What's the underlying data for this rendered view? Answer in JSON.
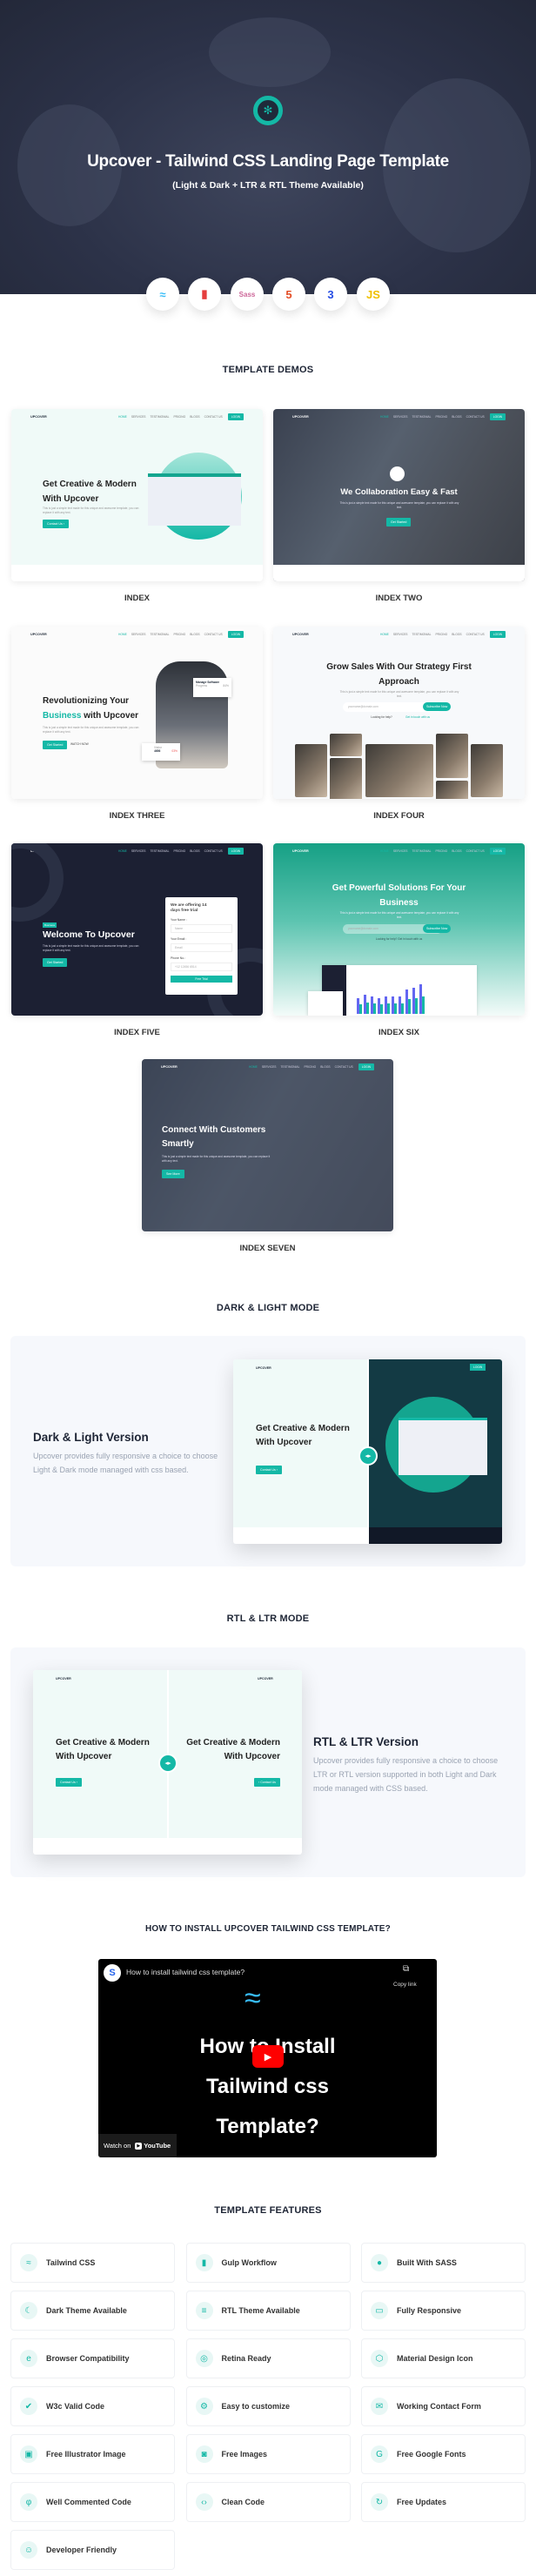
{
  "colors": {
    "accent": "#14b8a6",
    "hero_bg": "#2c3248",
    "dark": "#1c2033"
  },
  "hero": {
    "logo_icon": "upcover-logo-icon",
    "title": "Upcover - Tailwind CSS Landing Page Template",
    "subtitle": "(Light & Dark + LTR & RTL Theme Available)",
    "tech_icons": [
      {
        "name": "tailwind-icon",
        "glyph": "≈",
        "color": "#38bdf8"
      },
      {
        "name": "gulp-icon",
        "glyph": "▮",
        "color": "#e53e3e"
      },
      {
        "name": "sass-icon",
        "glyph": "Sass",
        "color": "#cd6799"
      },
      {
        "name": "html5-icon",
        "glyph": "5",
        "color": "#e44d26"
      },
      {
        "name": "css3-icon",
        "glyph": "3",
        "color": "#264de4"
      },
      {
        "name": "javascript-icon",
        "glyph": "JS",
        "color": "#f0c000"
      }
    ]
  },
  "demos_section": {
    "title": "TEMPLATE DEMOS"
  },
  "mock": {
    "brand": "UPCOVER",
    "nav": [
      "HOME",
      "SERVICES",
      "TESTIMONIAL",
      "PRICING",
      "BLOGS",
      "CONTACT US"
    ],
    "login": "LOGIN",
    "para": "This is just a simple text made for this unique and awesome template, you can replace it with any text."
  },
  "demos": [
    {
      "label": "INDEX",
      "heading": "Get Creative & Modern With Upcover",
      "button": "Contact Us ›"
    },
    {
      "label": "INDEX TWO",
      "heading": "We Collaboration Easy & Fast",
      "button": "Get Started"
    },
    {
      "label": "INDEX THREE",
      "heading": "Revolutionizing Your",
      "heading_accent": "Business",
      "heading_rest": "with Upcover",
      "button": "Get Started",
      "button2": "WATCH NOW",
      "card_title": "Manage Software",
      "card_progress": "Progress",
      "card_pct": "84%",
      "card2_label": "Visitor",
      "card2_value": "4656",
      "card2_pct": "03%"
    },
    {
      "label": "INDEX FOUR",
      "heading": "Grow Sales With Our Strategy First Approach",
      "input": "yourname@domain.com",
      "button": "Subscribe Now",
      "help": "Looking for help?",
      "help_link": "Get in touch with us"
    },
    {
      "label": "INDEX FIVE",
      "badge": "Business",
      "heading": "Welcome To Upcover",
      "button": "Get Started",
      "form_title": "We are offering 14 days free trial",
      "f1": "Your Name :",
      "p1": "Name",
      "f2": "Your Email :",
      "p2": "Email",
      "f3": "Phone No.:",
      "p3": "+12 12456 6514",
      "submit": "Free Trial"
    },
    {
      "label": "INDEX SIX",
      "heading": "Get Powerful Solutions For Your Business",
      "input": "yourname@domain.com",
      "button": "Subscribe Now",
      "help": "Looking for help? Get in touch with us"
    },
    {
      "label": "INDEX SEVEN",
      "heading": "Connect With Customers Smartly",
      "button": "See More"
    }
  ],
  "dark_light": {
    "section_title": "DARK & LIGHT MODE",
    "title": "Dark & Light Version",
    "description": "Upcover provides fully responsive a choice to choose Light & Dark mode managed with css based.",
    "mock_heading": "Get Creative & Modern With Upcover",
    "mock_button": "Contact Us ›"
  },
  "rtl_ltr": {
    "section_title": "RTL & LTR MODE",
    "title": "RTL & LTR Version",
    "description": "Upcover provides fully responsive a choice to choose LTR or RTL version supported in both Light and Dark mode managed with CSS based.",
    "mock_heading": "Get Creative & Modern With Upcover",
    "mock_button_ltr": "Contact Us ›",
    "mock_button_rtl": "‹ Contact Us"
  },
  "video": {
    "section_title": "HOW TO INSTALL UPCOVER TAILWIND CSS TEMPLATE?",
    "title": "How to install tailwind css template?",
    "copy_link": "Copy link",
    "overlay_lines": [
      "How to Install",
      "Tailwind css",
      "Template?"
    ],
    "watch_on": "Watch on",
    "youtube": "YouTube"
  },
  "features": {
    "title": "TEMPLATE FEATURES",
    "items": [
      {
        "label": "Tailwind CSS",
        "icon": "tailwind-icon",
        "glyph": "≈"
      },
      {
        "label": "Gulp Workflow",
        "icon": "gulp-icon",
        "glyph": "▮"
      },
      {
        "label": "Built With SASS",
        "icon": "sass-icon",
        "glyph": "●"
      },
      {
        "label": "Dark Theme Available",
        "icon": "moon-icon",
        "glyph": "☾"
      },
      {
        "label": "RTL Theme Available",
        "icon": "align-right-icon",
        "glyph": "≡"
      },
      {
        "label": "Fully Responsive",
        "icon": "monitor-icon",
        "glyph": "▭"
      },
      {
        "label": "Browser Compatibility",
        "icon": "browser-icon",
        "glyph": "e"
      },
      {
        "label": "Retina Ready",
        "icon": "eye-icon",
        "glyph": "◎"
      },
      {
        "label": "Material Design Icon",
        "icon": "cube-icon",
        "glyph": "⬡"
      },
      {
        "label": "W3c Valid Code",
        "icon": "verified-icon",
        "glyph": "✔"
      },
      {
        "label": "Easy to customize",
        "icon": "gear-icon",
        "glyph": "⚙"
      },
      {
        "label": "Working Contact Form",
        "icon": "contact-form-icon",
        "glyph": "✉"
      },
      {
        "label": "Free Illustrator Image",
        "icon": "image-file-icon",
        "glyph": "▣"
      },
      {
        "label": "Free Images",
        "icon": "camera-icon",
        "glyph": "◙"
      },
      {
        "label": "Free Google Fonts",
        "icon": "google-icon",
        "glyph": "G"
      },
      {
        "label": "Well Commented Code",
        "icon": "commit-icon",
        "glyph": "φ"
      },
      {
        "label": "Clean Code",
        "icon": "code-icon",
        "glyph": "‹›"
      },
      {
        "label": "Free Updates",
        "icon": "refresh-icon",
        "glyph": "↻"
      },
      {
        "label": "Developer Friendly",
        "icon": "developer-icon",
        "glyph": "☺"
      }
    ]
  }
}
